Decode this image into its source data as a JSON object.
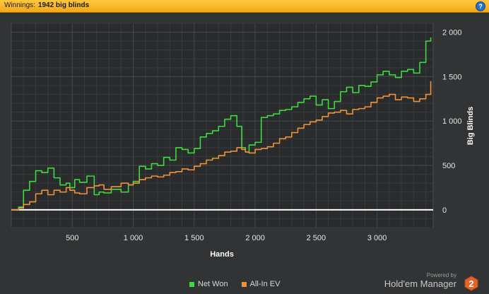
{
  "header": {
    "label": "Winnings:",
    "value": "1942 big blinds",
    "help_symbol": "?"
  },
  "chart_data": {
    "type": "line",
    "xlabel": "Hands",
    "ylabel": "Big Blinds",
    "xlim": [
      0,
      3460
    ],
    "ylim": [
      -200,
      2100
    ],
    "x_ticks": [
      500,
      1000,
      1500,
      2000,
      2500,
      3000
    ],
    "x_tick_labels": [
      "500",
      "1 000",
      "1 500",
      "2 000",
      "2 500",
      "3 000"
    ],
    "y_ticks": [
      0,
      500,
      1000,
      1500,
      2000
    ],
    "y_tick_labels": [
      "0",
      "500",
      "1 000",
      "1 500",
      "2 000"
    ],
    "grid": true,
    "legend_position": "bottom-center",
    "series": [
      {
        "name": "Net Won",
        "color": "#3ddc3d",
        "x": [
          0,
          60,
          100,
          150,
          200,
          250,
          300,
          350,
          400,
          450,
          480,
          520,
          560,
          620,
          680,
          720,
          760,
          820,
          900,
          960,
          1000,
          1050,
          1100,
          1150,
          1200,
          1250,
          1300,
          1350,
          1400,
          1450,
          1500,
          1550,
          1600,
          1650,
          1700,
          1750,
          1800,
          1850,
          1890,
          1920,
          1950,
          2000,
          2050,
          2100,
          2150,
          2200,
          2250,
          2300,
          2350,
          2400,
          2450,
          2500,
          2550,
          2600,
          2650,
          2700,
          2750,
          2800,
          2850,
          2900,
          2950,
          3000,
          3050,
          3100,
          3150,
          3200,
          3250,
          3300,
          3350,
          3400,
          3440
        ],
        "y": [
          0,
          30,
          220,
          320,
          440,
          420,
          470,
          360,
          280,
          300,
          250,
          340,
          310,
          380,
          170,
          200,
          190,
          230,
          200,
          280,
          320,
          490,
          460,
          520,
          500,
          590,
          560,
          700,
          680,
          640,
          690,
          820,
          860,
          890,
          940,
          1020,
          1060,
          940,
          700,
          650,
          730,
          760,
          1040,
          1060,
          1080,
          1120,
          1130,
          1160,
          1210,
          1250,
          1280,
          1180,
          1240,
          1140,
          1220,
          1330,
          1380,
          1320,
          1400,
          1390,
          1440,
          1520,
          1560,
          1520,
          1490,
          1560,
          1580,
          1540,
          1660,
          1900,
          1940
        ]
      },
      {
        "name": "All-In EV",
        "color": "#f0923a",
        "x": [
          0,
          60,
          100,
          150,
          200,
          250,
          300,
          350,
          400,
          450,
          480,
          520,
          560,
          620,
          680,
          720,
          760,
          820,
          900,
          960,
          1000,
          1050,
          1100,
          1150,
          1200,
          1250,
          1300,
          1350,
          1400,
          1450,
          1500,
          1550,
          1600,
          1650,
          1700,
          1750,
          1800,
          1850,
          1890,
          1920,
          1950,
          2000,
          2050,
          2100,
          2150,
          2200,
          2250,
          2300,
          2350,
          2400,
          2450,
          2500,
          2550,
          2600,
          2650,
          2700,
          2750,
          2800,
          2850,
          2900,
          2950,
          3000,
          3050,
          3100,
          3150,
          3200,
          3250,
          3300,
          3350,
          3400,
          3440
        ],
        "y": [
          0,
          20,
          60,
          90,
          180,
          220,
          170,
          220,
          200,
          250,
          220,
          190,
          180,
          250,
          270,
          280,
          230,
          260,
          300,
          280,
          300,
          340,
          360,
          380,
          370,
          390,
          420,
          430,
          460,
          450,
          490,
          520,
          560,
          580,
          610,
          650,
          660,
          700,
          680,
          650,
          640,
          680,
          690,
          710,
          750,
          800,
          820,
          870,
          920,
          960,
          990,
          1010,
          1050,
          1090,
          1100,
          1120,
          1080,
          1130,
          1140,
          1160,
          1210,
          1260,
          1280,
          1300,
          1240,
          1270,
          1260,
          1220,
          1250,
          1300,
          1450
        ]
      }
    ]
  },
  "legend": {
    "items": [
      {
        "label": "Net Won",
        "color": "#3ddc3d"
      },
      {
        "label": "All-In EV",
        "color": "#f0923a"
      }
    ]
  },
  "branding": {
    "powered_by": "Powered by",
    "product": "Hold'em Manager",
    "logo_digit": "2"
  }
}
